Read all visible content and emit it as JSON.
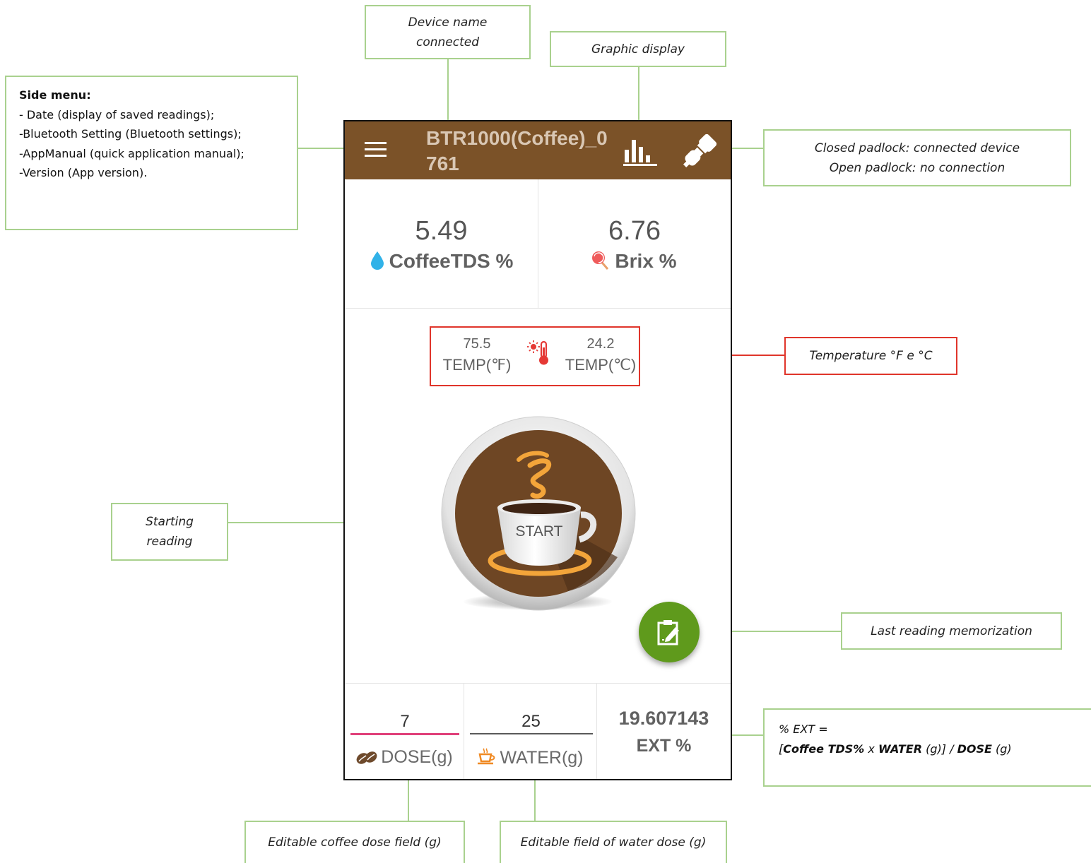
{
  "annotations": {
    "device_name": [
      "Device name",
      "connected"
    ],
    "graphic_display": "Graphic display",
    "side_menu": {
      "header": "Side menu:",
      "items": [
        "- Date (display of saved readings);",
        "-Bluetooth Setting (Bluetooth settings);",
        "-AppManual (quick application manual);",
        "-Version (App version)."
      ]
    },
    "padlock": [
      "Closed padlock: connected device",
      "Open padlock: no connection"
    ],
    "temperature": "Temperature °F e °C",
    "starting_reading": [
      "Starting",
      "reading"
    ],
    "last_reading": "Last reading memorization",
    "formula": {
      "line1": "% EXT =",
      "open": "[",
      "tds": "Coffee TDS%",
      "times": " x ",
      "water": "WATER",
      "water_unit": " (g)] / ",
      "dose": "DOSE",
      "dose_unit": " (g)"
    },
    "dose_field": "Editable coffee dose field (g)",
    "water_field": "Editable field of water dose (g)"
  },
  "app": {
    "device_name": "BTR1000(Coffee)_0761",
    "icons": {
      "menu": "hamburger-menu-icon",
      "graph": "bar-chart-icon",
      "connection": "plug-connected-icon",
      "tds": "water-drop-icon",
      "brix": "lollipop-icon",
      "temp": "thermometer-sun-icon",
      "save": "clipboard-edit-icon",
      "dose": "coffee-beans-icon",
      "water": "cup-icon"
    },
    "tds": {
      "value": "5.49",
      "label": "CoffeeTDS %"
    },
    "brix": {
      "value": "6.76",
      "label": "Brix %"
    },
    "temp_f": {
      "value": "75.5",
      "label": "TEMP(℉)"
    },
    "temp_c": {
      "value": "24.2",
      "label": "TEMP(℃)"
    },
    "start_label": "START",
    "dose": {
      "value": "7",
      "label": "DOSE(g)"
    },
    "water": {
      "value": "25",
      "label": "WATER(g)"
    },
    "ext": {
      "value": "19.607143",
      "label": "EXT %"
    },
    "colors": {
      "topbar": "#7b5228",
      "fab": "#5f9a1c",
      "dose_underline_active": "#e0407a",
      "callout_border": "#a9d18e",
      "temp_callout_border": "#e0352b"
    }
  }
}
